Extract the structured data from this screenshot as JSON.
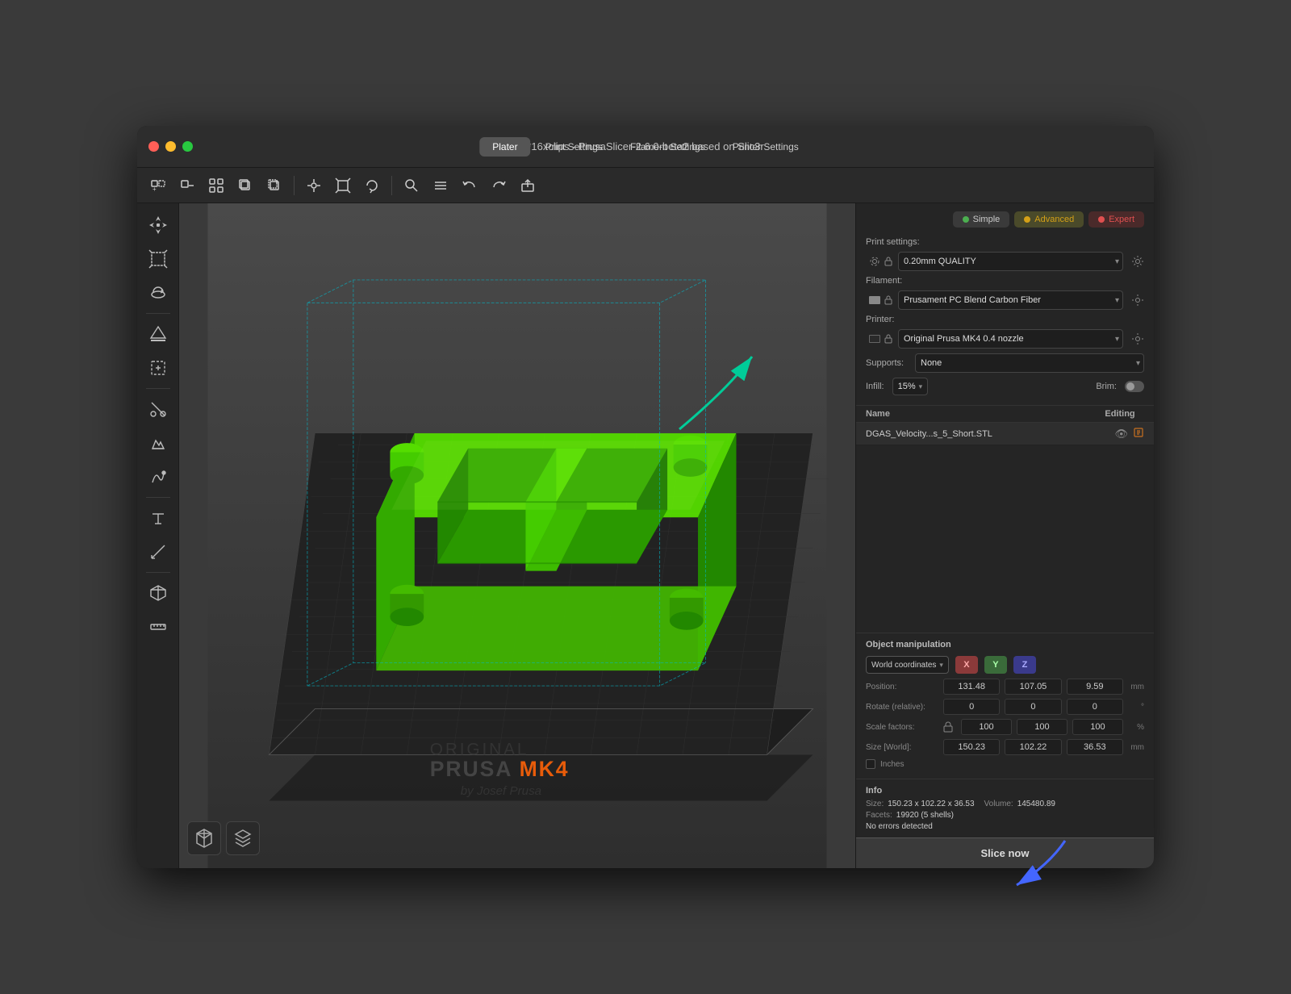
{
  "window": {
    "title": "*16xclips - PrusaSlicer-2.6.0-beta2 based on Slic3r"
  },
  "nav": {
    "tabs": [
      "Plater",
      "Print Settings",
      "Filament Settings",
      "Printer Settings"
    ],
    "active": "Plater"
  },
  "toolbar": {
    "buttons": [
      "add-part",
      "remove",
      "arrange",
      "copy",
      "paste",
      "move",
      "scale",
      "rotate",
      "cut",
      "search",
      "settings",
      "undo",
      "redo",
      "export"
    ]
  },
  "left_toolbar": {
    "buttons": [
      "move3d",
      "scale3d",
      "rotate3d",
      "place-on-face",
      "cut",
      "support-paint",
      "seam-paint",
      "text",
      "measure",
      "assembly"
    ]
  },
  "mode_selector": {
    "simple_label": "Simple",
    "advanced_label": "Advanced",
    "expert_label": "Expert"
  },
  "print_settings": {
    "label": "Print settings:",
    "value": "0.20mm QUALITY",
    "filament_label": "Filament:",
    "filament_value": "Prusament PC Blend Carbon Fiber",
    "printer_label": "Printer:",
    "printer_value": "Original Prusa MK4 0.4 nozzle",
    "supports_label": "Supports:",
    "supports_value": "None",
    "infill_label": "Infill:",
    "infill_value": "15%",
    "brim_label": "Brim:"
  },
  "object_list": {
    "col_name": "Name",
    "col_editing": "Editing",
    "items": [
      {
        "name": "DGAS_Velocity...s_5_Short.STL",
        "has_eye": true,
        "has_edit": true
      }
    ]
  },
  "object_manipulation": {
    "title": "Object manipulation",
    "world_coordinates": "World coordinates",
    "axes": [
      "X",
      "Y",
      "Z"
    ],
    "position_label": "Position:",
    "position_x": "131.48",
    "position_y": "107.05",
    "position_z": "9.59",
    "position_unit": "mm",
    "rotate_label": "Rotate (relative):",
    "rotate_x": "0",
    "rotate_y": "0",
    "rotate_z": "0",
    "rotate_unit": "°",
    "scale_label": "Scale factors:",
    "scale_x": "100",
    "scale_y": "100",
    "scale_z": "100",
    "scale_unit": "%",
    "size_label": "Size [World]:",
    "size_x": "150.23",
    "size_y": "102.22",
    "size_z": "36.53",
    "size_unit": "mm",
    "inches_label": "Inches"
  },
  "info": {
    "title": "Info",
    "size_label": "Size:",
    "size_value": "150.23 x 102.22 x 36.53",
    "volume_label": "Volume:",
    "volume_value": "145480.89",
    "facets_label": "Facets:",
    "facets_value": "19920 (5 shells)",
    "no_errors": "No errors detected"
  },
  "slice_button": {
    "label": "Slice now"
  },
  "viewport": {
    "brand_line1": "ORIGINAL",
    "brand_prusa": "PRUSA",
    "brand_mk4": "MK4",
    "brand_line2": "by Josef Prusa"
  }
}
